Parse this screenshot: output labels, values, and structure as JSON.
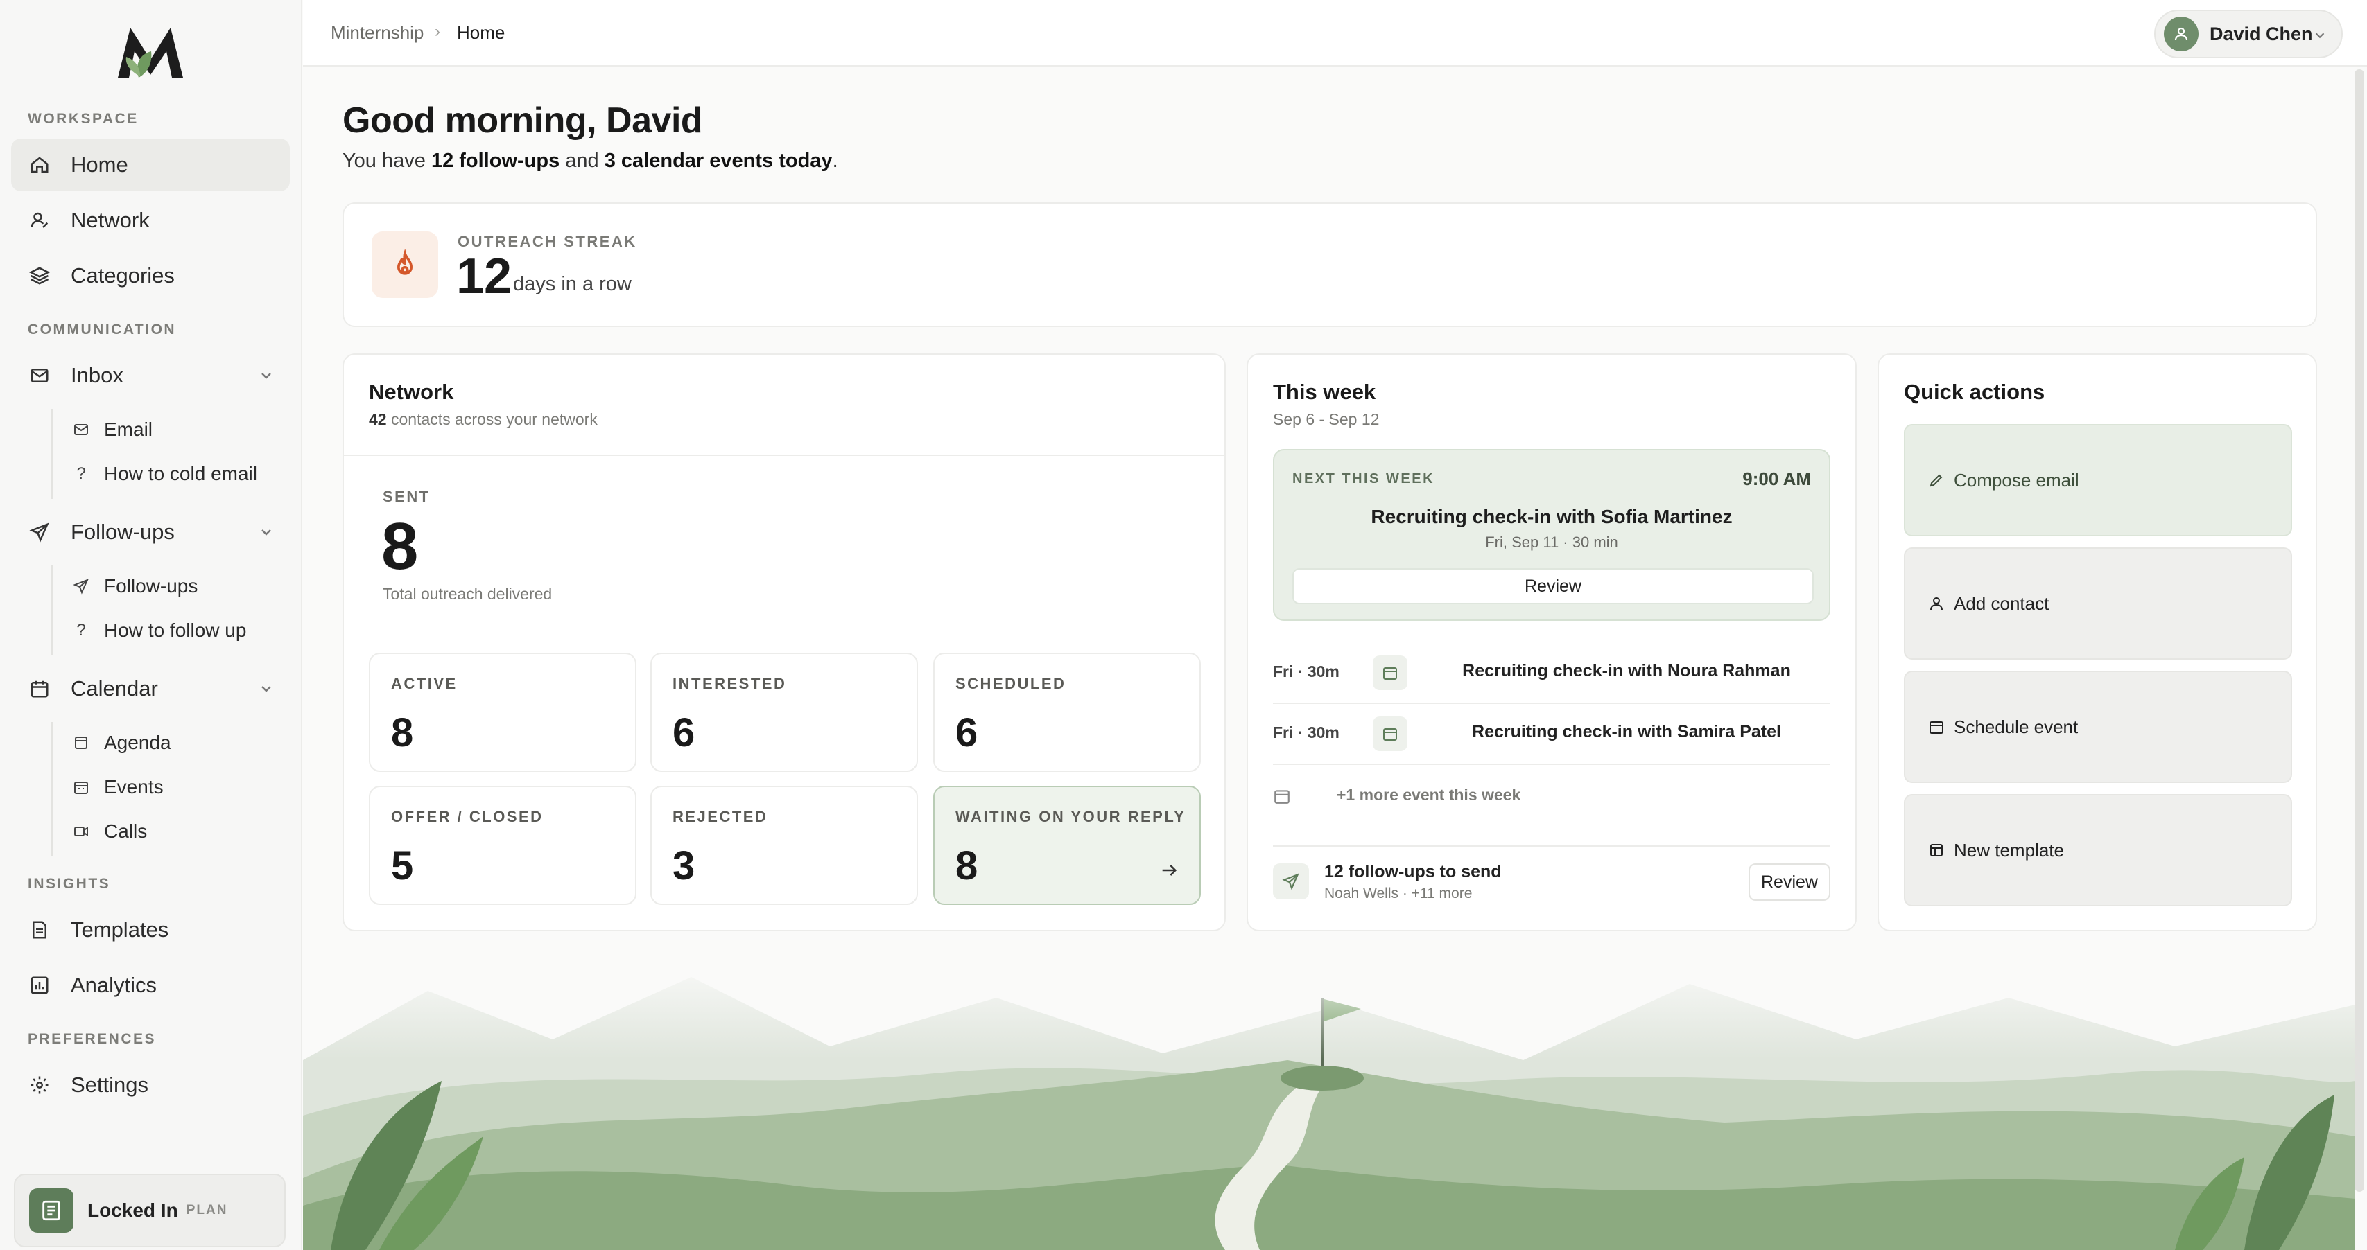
{
  "app": {
    "name": "Minternship"
  },
  "sidebar": {
    "sections": {
      "workspace": "WORKSPACE",
      "communication": "COMMUNICATION",
      "insights": "INSIGHTS",
      "preferences": "PREFERENCES"
    },
    "items": {
      "home": "Home",
      "network": "Network",
      "categories": "Categories",
      "inbox": "Inbox",
      "email": "Email",
      "how_cold": "How to cold email",
      "followups": "Follow-ups",
      "followups_sub": "Follow-ups",
      "how_follow": "How to follow up",
      "calendar": "Calendar",
      "agenda": "Agenda",
      "events": "Events",
      "calls": "Calls",
      "templates": "Templates",
      "analytics": "Analytics",
      "settings": "Settings"
    },
    "plan": {
      "name": "Locked In",
      "tag": "PLAN"
    }
  },
  "topbar": {
    "breadcrumb_root": "Minternship",
    "breadcrumb_sep": "›",
    "breadcrumb_current": "Home",
    "user_name": "David Chen"
  },
  "greeting": {
    "title": "Good morning, David",
    "pre": "You have ",
    "followups": "12 follow-ups",
    "mid": " and ",
    "events": "3 calendar events today",
    "post": "."
  },
  "streak": {
    "label": "OUTREACH STREAK",
    "value": "12",
    "unit": "days in a row"
  },
  "network": {
    "title": "Network",
    "count": "42",
    "count_suffix": " contacts across your network",
    "sent_label": "SENT",
    "sent_value": "8",
    "sent_desc": "Total outreach delivered",
    "stats": [
      {
        "label": "ACTIVE",
        "value": "8"
      },
      {
        "label": "INTERESTED",
        "value": "6"
      },
      {
        "label": "SCHEDULED",
        "value": "6"
      },
      {
        "label": "OFFER / CLOSED",
        "value": "5"
      },
      {
        "label": "REJECTED",
        "value": "3"
      },
      {
        "label": "WAITING ON YOUR REPLY",
        "value": "8"
      }
    ]
  },
  "week": {
    "title": "This week",
    "range": "Sep 6 - Sep 12",
    "next_label": "NEXT THIS WEEK",
    "next_time": "9:00 AM",
    "next_title": "Recruiting check-in with Sofia Martinez",
    "next_when": "Fri, Sep 11 · 30 min",
    "next_button": "Review",
    "events": [
      {
        "when": "Fri · 30m",
        "title": "Recruiting check-in with Noura Rahman"
      },
      {
        "when": "Fri · 30m",
        "title": "Recruiting check-in with Samira Patel"
      }
    ],
    "more": "+1 more event this week",
    "followups_title": "12 follow-ups to send",
    "followups_sub": "Noah Wells · +11 more",
    "followups_button": "Review"
  },
  "quick": {
    "title": "Quick actions",
    "actions": [
      "Compose email",
      "Add contact",
      "Schedule event",
      "New template"
    ]
  },
  "colors": {
    "accent": "#5e7d5a",
    "streak_flame": "#d4572a",
    "highlight": "#eef3ec"
  }
}
